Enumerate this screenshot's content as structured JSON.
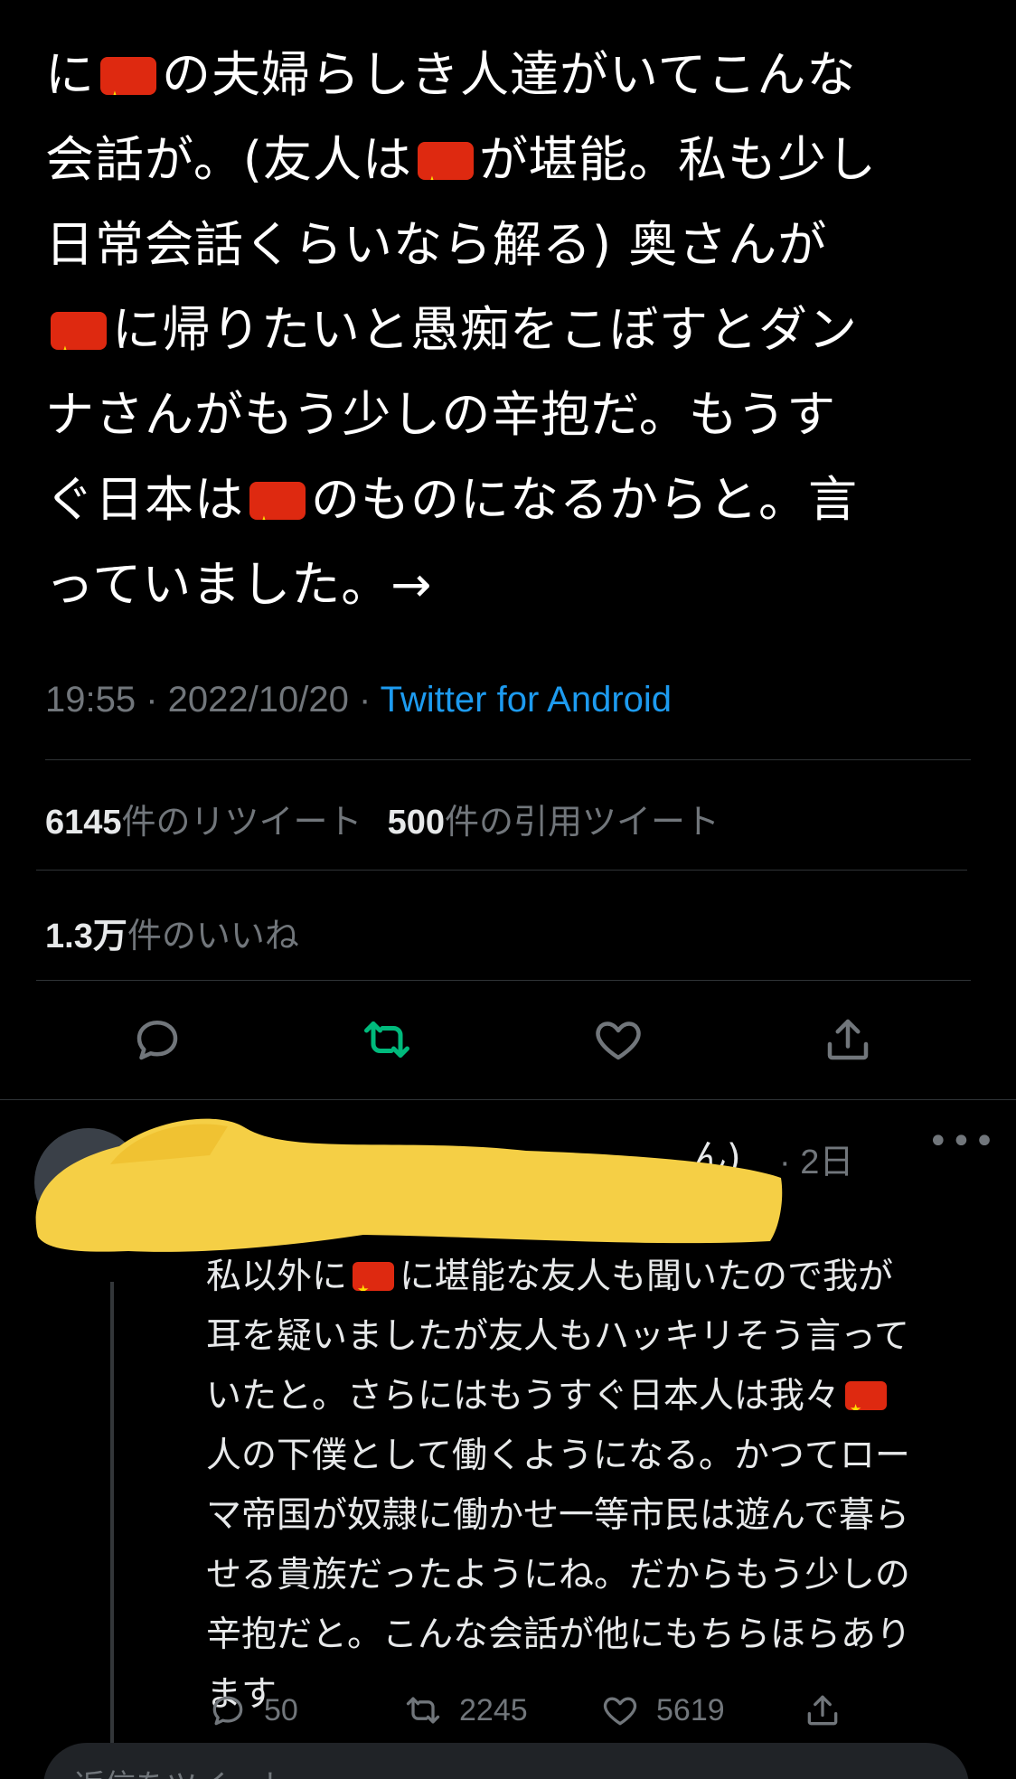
{
  "tweet": {
    "lines": [
      [
        "に",
        "flag",
        "の夫婦らしき人達がいてこんな"
      ],
      [
        "会話が。(友人は",
        "flag",
        "が堪能。私も少し"
      ],
      [
        "日常会話くらいなら解る) 奥さんが"
      ],
      [
        "flag",
        "に帰りたいと愚痴をこぼすとダン"
      ],
      [
        "ナさんがもう少しの辛抱だ。もうす"
      ],
      [
        "ぐ日本は",
        "flag",
        "のものになるからと。言"
      ],
      [
        "っていました。→"
      ]
    ],
    "timestamp": "19:55 · 2022/10/20 · ",
    "source": "Twitter for Android"
  },
  "stats": {
    "retweets_count": "6145",
    "retweets_label": "件のリツイート",
    "quotes_count": "500",
    "quotes_label": "件の引用ツイート",
    "likes_count": "1.3万",
    "likes_label": "件のいいね"
  },
  "actions": {
    "icons": [
      "reply-icon",
      "retweet-icon",
      "like-icon",
      "share-icon"
    ],
    "retweet_active_color": "#00ba7c"
  },
  "reply": {
    "name_tail": "ん)",
    "time": "· 2日",
    "more": "•••",
    "lines": [
      [
        "私以外に",
        "flag",
        "に堪能な友人も聞いたので我が"
      ],
      [
        "耳を疑いましたが友人もハッキリそう言って"
      ],
      [
        "いたと。さらにはもうすぐ日本人は我々",
        "flag"
      ],
      [
        "人の下僕として働くようになる。かつてロー"
      ],
      [
        "マ帝国が奴隷に働かせ一等市民は遊んで暮ら"
      ],
      [
        "せる貴族だったようにね。だからもう少しの"
      ],
      [
        "辛抱だと。こんな会話が他にもちらほらあり"
      ],
      [
        "ます"
      ]
    ],
    "reply_count": "50",
    "retweet_count": "2245",
    "like_count": "5619"
  },
  "compose": {
    "placeholder": "返信をツイート"
  },
  "colors": {
    "background": "#000000",
    "text": "#e7e9ea",
    "muted": "#71767b",
    "link": "#1d9bf0",
    "flag_red": "#de2910",
    "flag_star": "#ffde00",
    "redaction": "#f5cf45"
  }
}
